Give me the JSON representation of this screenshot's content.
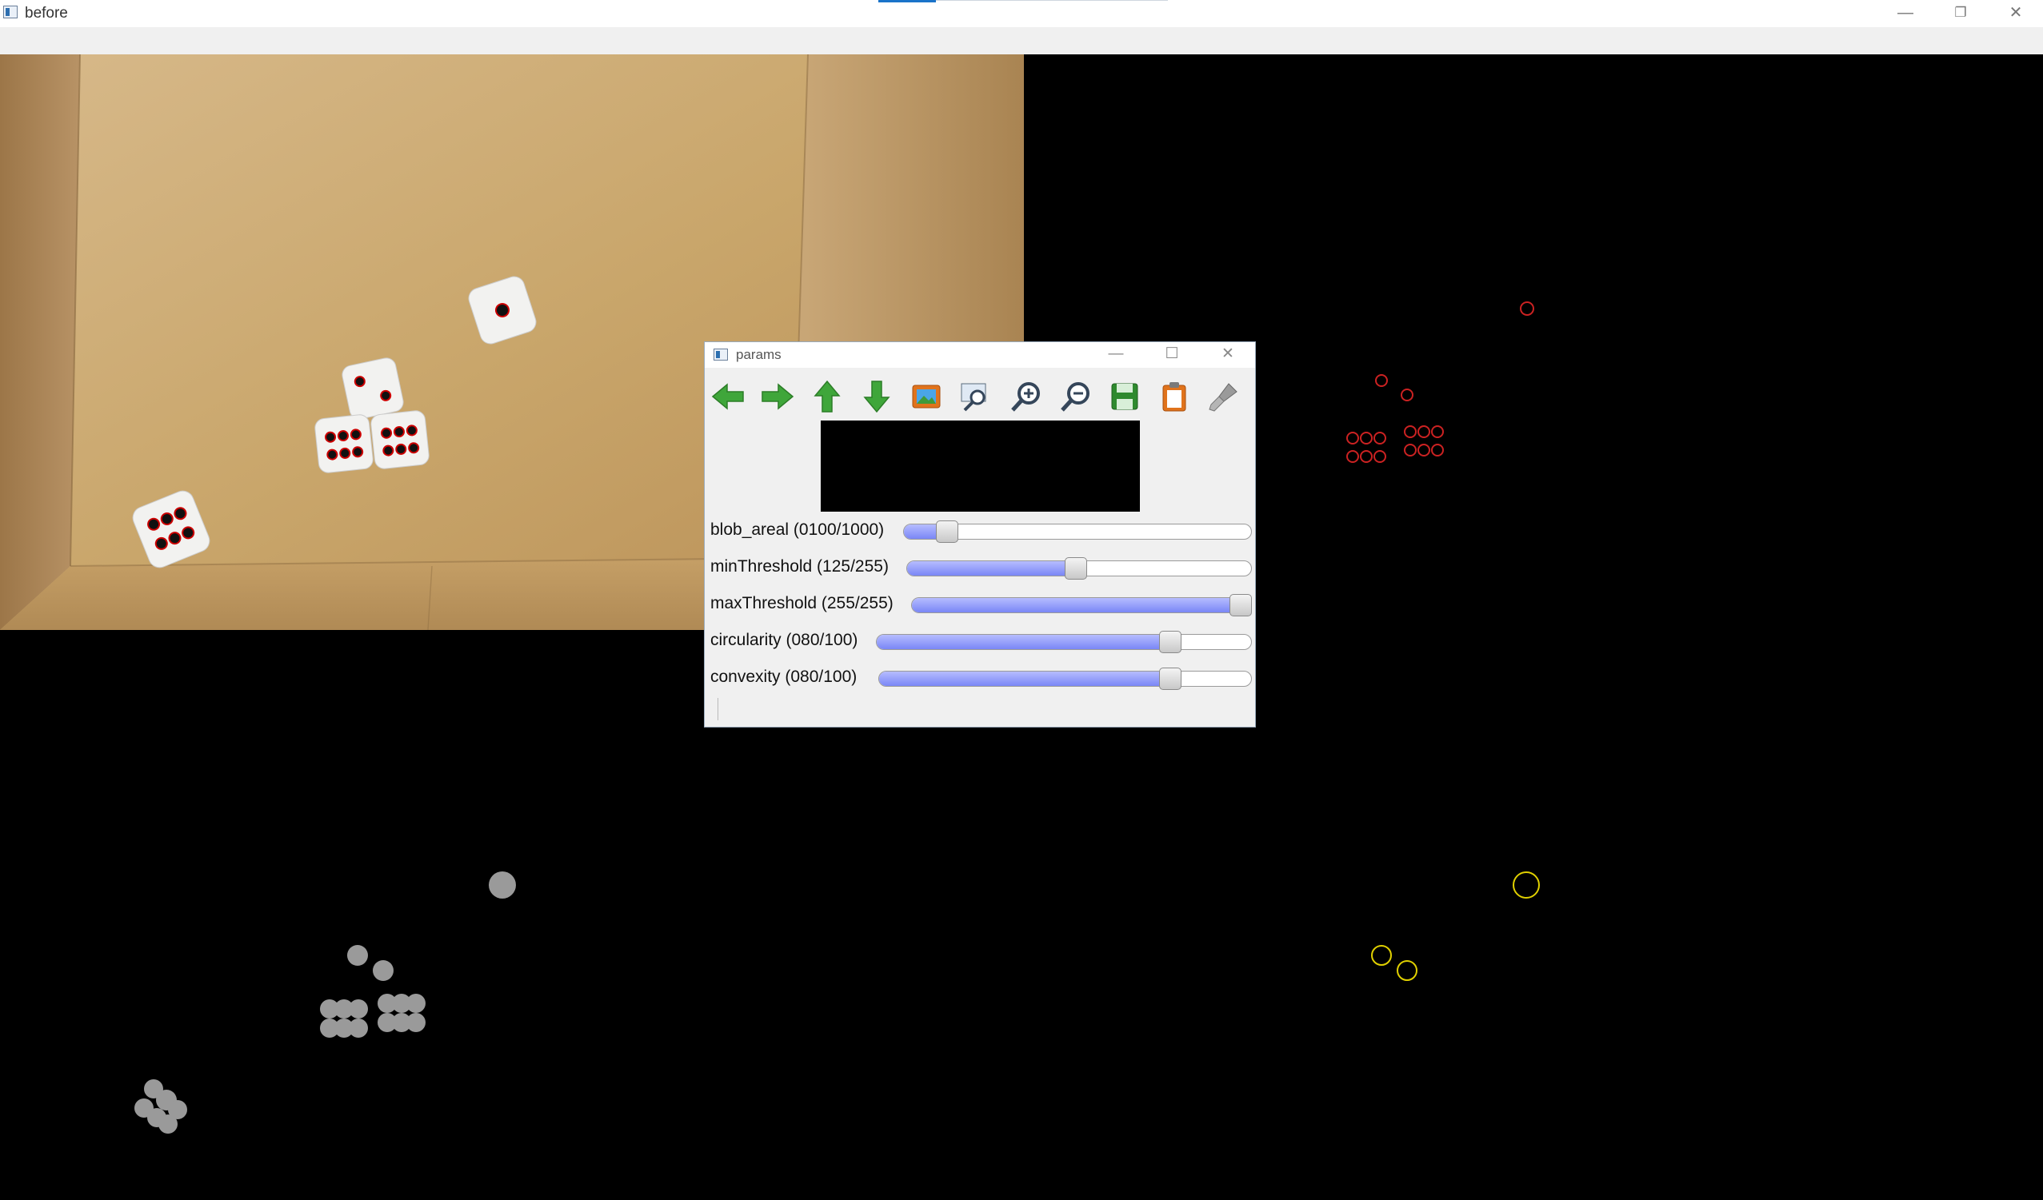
{
  "window": {
    "title": "before",
    "controls": {
      "minimize": "—",
      "restore": "❐",
      "close": "✕"
    }
  },
  "params_dialog": {
    "title": "params",
    "controls": {
      "minimize": "—",
      "maximize": "☐",
      "close": "✕"
    },
    "toolbar": [
      {
        "name": "pan-left-icon"
      },
      {
        "name": "pan-right-icon"
      },
      {
        "name": "pan-up-icon"
      },
      {
        "name": "pan-down-icon"
      },
      {
        "name": "save-image-icon"
      },
      {
        "name": "zoom-fit-icon"
      },
      {
        "name": "zoom-in-icon"
      },
      {
        "name": "zoom-out-icon"
      },
      {
        "name": "save-icon"
      },
      {
        "name": "copy-to-clipboard-icon"
      },
      {
        "name": "properties-brush-icon"
      }
    ],
    "trackbars": [
      {
        "label": "blob_areal (0100/1000)",
        "value": 100,
        "max": 1000
      },
      {
        "label": "minThreshold (125/255)",
        "value": 125,
        "max": 255
      },
      {
        "label": "maxThreshold (255/255)",
        "value": 255,
        "max": 255
      },
      {
        "label": "circularity (080/100)",
        "value": 80,
        "max": 100
      },
      {
        "label": "convexity  (080/100)",
        "value": 80,
        "max": 100
      }
    ]
  },
  "colors": {
    "accent": "#1a73c9",
    "cardboard": "#c9a66b",
    "red_circles": "#cc2222",
    "yellow_circles": "#e0d000",
    "gray_blobs": "#9a9a9a",
    "slider_fill": "#8a94f8"
  }
}
